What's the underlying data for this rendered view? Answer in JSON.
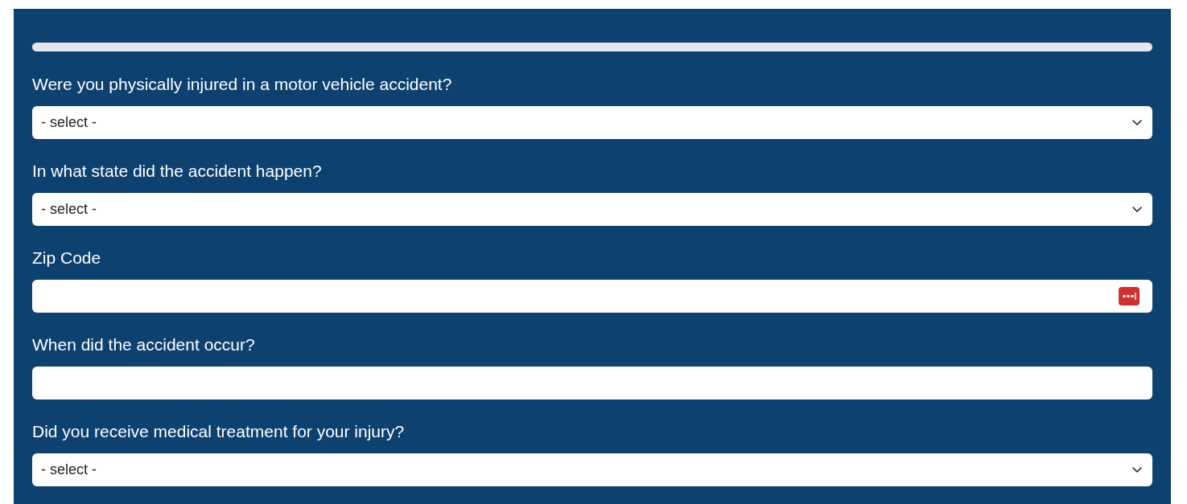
{
  "progress": {
    "level": 0
  },
  "fields": [
    {
      "kind": "select",
      "label": "Were you physically injured in a motor vehicle accident?",
      "value": "- select -"
    },
    {
      "kind": "select",
      "label": "In what state did the accident happen?",
      "value": "- select -"
    },
    {
      "kind": "text",
      "label": "Zip Code",
      "autofill_icon": true
    },
    {
      "kind": "text",
      "label": "When did the accident occur?",
      "autofill_icon": false
    },
    {
      "kind": "select",
      "label": "Did you receive medical treatment for your injury?",
      "value": "- select -"
    }
  ]
}
